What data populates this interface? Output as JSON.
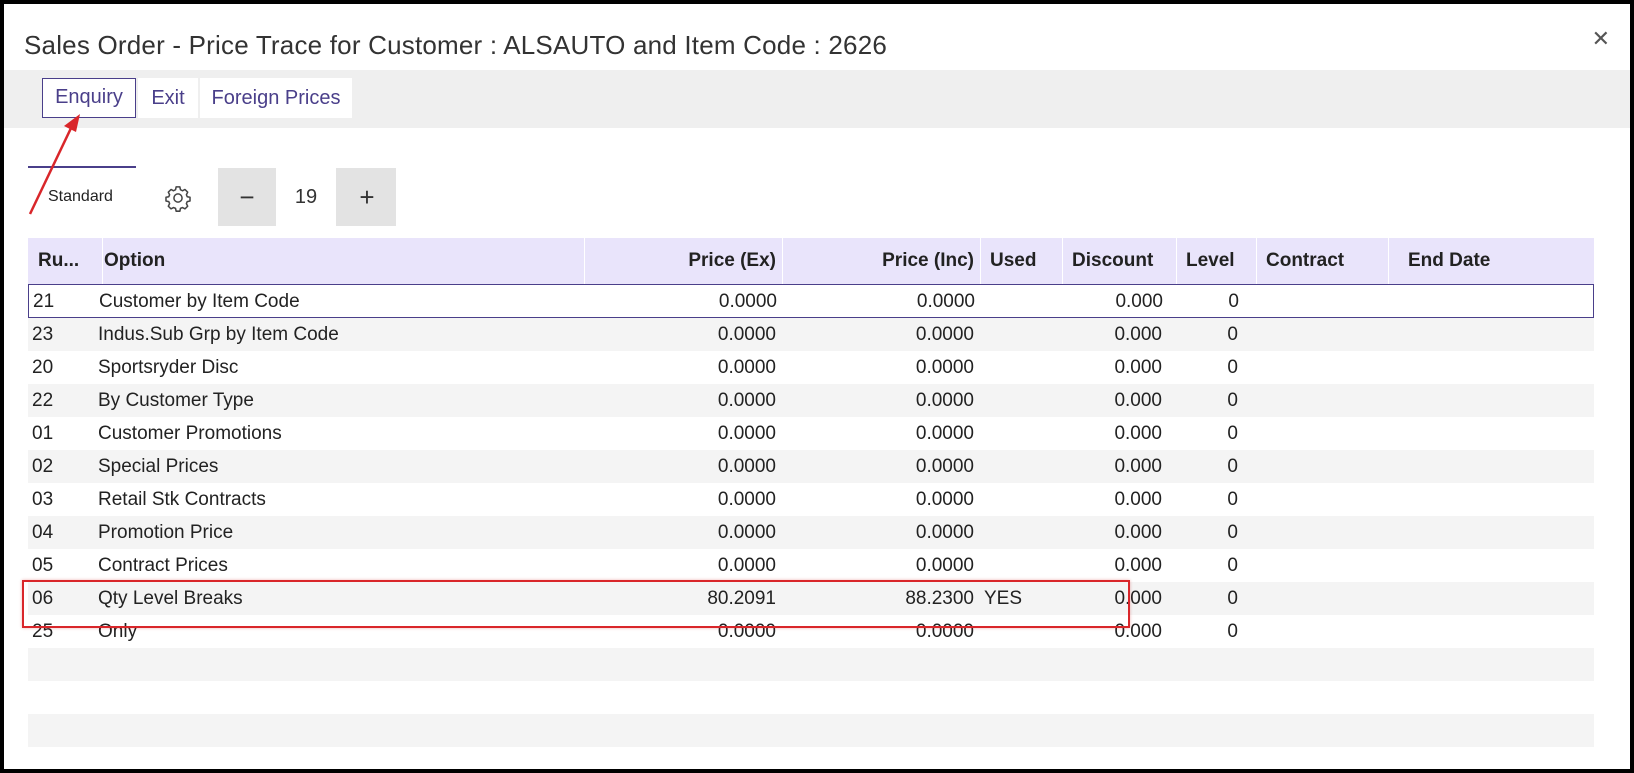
{
  "window": {
    "title": "Sales Order - Price Trace for Customer : ALSAUTO and Item Code : 2626",
    "close_icon": "close-icon"
  },
  "toolbar": {
    "enquiry_label": "Enquiry",
    "exit_label": "Exit",
    "foreign_prices_label": "Foreign Prices"
  },
  "view": {
    "label": "Standard",
    "settings_icon": "gear-icon"
  },
  "stepper": {
    "minus": "−",
    "value": "19",
    "plus": "+"
  },
  "grid": {
    "columns": [
      "Ru...",
      "Option",
      "Price (Ex)",
      "Price (Inc)",
      "Used",
      "Discount",
      "Level",
      "Contract",
      "End Date"
    ],
    "rows": [
      {
        "rule": "21",
        "option": "Customer by Item Code",
        "price_ex": "0.0000",
        "price_inc": "0.0000",
        "used": "",
        "discount": "0.000",
        "level": "0",
        "contract": "",
        "end_date": ""
      },
      {
        "rule": "23",
        "option": "Indus.Sub Grp by Item Code",
        "price_ex": "0.0000",
        "price_inc": "0.0000",
        "used": "",
        "discount": "0.000",
        "level": "0",
        "contract": "",
        "end_date": ""
      },
      {
        "rule": "20",
        "option": "Sportsryder Disc",
        "price_ex": "0.0000",
        "price_inc": "0.0000",
        "used": "",
        "discount": "0.000",
        "level": "0",
        "contract": "",
        "end_date": ""
      },
      {
        "rule": "22",
        "option": "By Customer Type",
        "price_ex": "0.0000",
        "price_inc": "0.0000",
        "used": "",
        "discount": "0.000",
        "level": "0",
        "contract": "",
        "end_date": ""
      },
      {
        "rule": "01",
        "option": "Customer Promotions",
        "price_ex": "0.0000",
        "price_inc": "0.0000",
        "used": "",
        "discount": "0.000",
        "level": "0",
        "contract": "",
        "end_date": ""
      },
      {
        "rule": "02",
        "option": "Special Prices",
        "price_ex": "0.0000",
        "price_inc": "0.0000",
        "used": "",
        "discount": "0.000",
        "level": "0",
        "contract": "",
        "end_date": ""
      },
      {
        "rule": "03",
        "option": "Retail Stk Contracts",
        "price_ex": "0.0000",
        "price_inc": "0.0000",
        "used": "",
        "discount": "0.000",
        "level": "0",
        "contract": "",
        "end_date": ""
      },
      {
        "rule": "04",
        "option": "Promotion Price",
        "price_ex": "0.0000",
        "price_inc": "0.0000",
        "used": "",
        "discount": "0.000",
        "level": "0",
        "contract": "",
        "end_date": ""
      },
      {
        "rule": "05",
        "option": "Contract Prices",
        "price_ex": "0.0000",
        "price_inc": "0.0000",
        "used": "",
        "discount": "0.000",
        "level": "0",
        "contract": "",
        "end_date": ""
      },
      {
        "rule": "06",
        "option": "Qty Level Breaks",
        "price_ex": "80.2091",
        "price_inc": "88.2300",
        "used": "YES",
        "discount": "0.000",
        "level": "0",
        "contract": "",
        "end_date": ""
      },
      {
        "rule": "25",
        "option": " Only",
        "price_ex": "0.0000",
        "price_inc": "0.0000",
        "used": "",
        "discount": "0.000",
        "level": "0",
        "contract": "",
        "end_date": ""
      }
    ]
  },
  "annotation": {
    "highlight_color": "#d9262a"
  },
  "colors": {
    "accent": "#4a3f8a",
    "header_bg": "#e9e4fb",
    "toolbar_bg": "#efefef"
  }
}
